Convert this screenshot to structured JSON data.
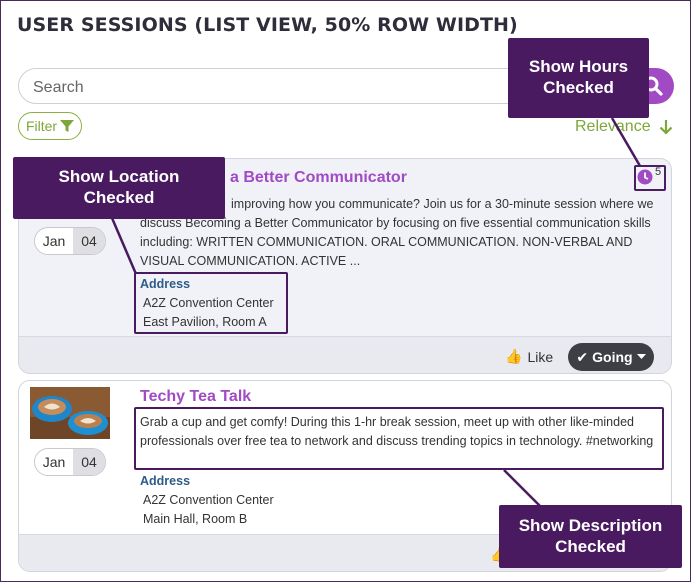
{
  "page": {
    "title": "USER SESSIONS (LIST VIEW, 50% ROW WIDTH)"
  },
  "search": {
    "placeholder": "Search"
  },
  "toolbar": {
    "filter_label": "Filter",
    "sort_label": "Relevance"
  },
  "sessions": [
    {
      "title": "a Better Communicator",
      "month": "Jan",
      "day": "04",
      "description": "improving how you communicate? Join us for a 30-minute session where we discuss Becoming a Better Communicator by focusing on five essential communication skills including: WRITTEN COMMUNICATION. ORAL COMMUNICATION. NON-VERBAL AND VISUAL COMMUNICATION. ACTIVE ...",
      "address_label": "Address",
      "address_lines": [
        "A2Z Convention Center",
        "East Pavilion, Room A"
      ],
      "hours": "5",
      "like_label": "Like",
      "going_label": "Going"
    },
    {
      "title": "Techy Tea Talk",
      "month": "Jan",
      "day": "04",
      "description": "Grab a cup and get comfy! During this 1-hr break session, meet up with other like-minded professionals over free tea to network and discuss trending topics in technology. #networking",
      "address_label": "Address",
      "address_lines": [
        "A2Z Convention Center",
        "Main Hall, Room B"
      ]
    }
  ],
  "annotations": {
    "hours": "Show Hours\nChecked",
    "location": "Show Location\nChecked",
    "description": "Show Description\nChecked"
  },
  "colors": {
    "accent": "#a24ac4",
    "green": "#7fa63a",
    "annotation": "#4a1a60",
    "address": "#2e5b8a"
  }
}
